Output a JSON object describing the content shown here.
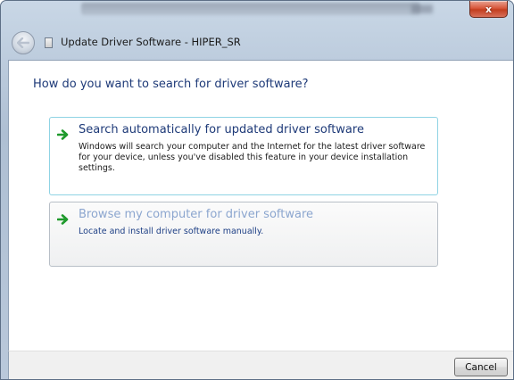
{
  "window": {
    "title": "Update Driver Software - HIPER_SR",
    "close_glyph": "x"
  },
  "icons": {
    "back": "back-arrow-icon",
    "app": "driver-app-icon",
    "option_arrow": "green-arrow-icon",
    "close": "close-icon"
  },
  "content": {
    "heading": "How do you want to search for driver software?",
    "options": [
      {
        "title": "Search automatically for updated driver software",
        "description": "Windows will search your computer and the Internet for the latest driver software for your device, unless you've disabled this feature in your device installation settings."
      },
      {
        "title": "Browse my computer for driver software",
        "description": "Locate and install driver software manually."
      }
    ]
  },
  "footer": {
    "cancel_label": "Cancel"
  },
  "colors": {
    "heading": "#1e3a78",
    "arrow_green": "#1f9a2c",
    "hover_border": "#8fd3e4",
    "close_red": "#c33e1f"
  }
}
